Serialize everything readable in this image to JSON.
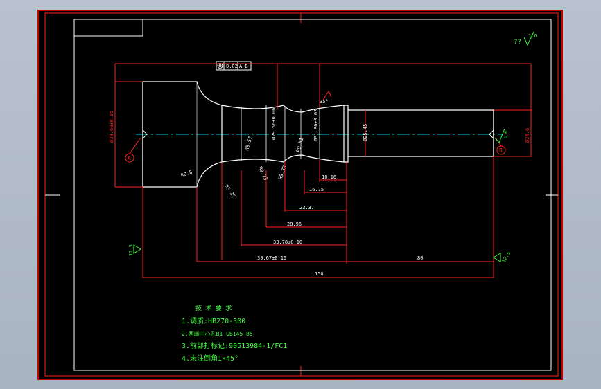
{
  "colors": {
    "background": "#000000",
    "frame": "#ff2020",
    "outline": "#ffffff",
    "dimension": "#ff2020",
    "centerline": "#00d8d8",
    "note_text": "#40ff40",
    "symbol": "#40ff40"
  },
  "roughness": {
    "general_prefix": "??",
    "general_value": "1.6",
    "left_value": "12.5",
    "right_value": "12.5",
    "shaft_end_value": "1.6"
  },
  "tolerance_frame": {
    "symbol": "circular-runout",
    "value": "0.02",
    "datum": "A-B"
  },
  "datums": {
    "left": "A",
    "right": "B"
  },
  "diameters": {
    "flange": "Ø39.60±0.05",
    "groove": "Ø29.56±0.06",
    "collar": "Ø31.80±0.03",
    "shaft": "Ø25.45",
    "end": "Ø24.0"
  },
  "radii": {
    "r1": "R0.8",
    "r2": "R5.25",
    "r3": "R9.57",
    "r4": "R9.23",
    "r5": "R9.33",
    "r6": "R9.51"
  },
  "angle": "35°",
  "lengths": {
    "d1": "10.16",
    "d2": "16.75",
    "d3": "23.37",
    "d4": "28.96",
    "d5": "33.78±0.10",
    "d6": "39.67±0.10",
    "d7": "80",
    "total": "150"
  },
  "technical_requirements": {
    "title": "技 术 要 求",
    "items": [
      "1.调质:HB270-300",
      "2.两端中心孔B1 GB145-85",
      "3.前部打标记:90513984-1/FC1",
      "4.未注倒角1×45°"
    ]
  }
}
